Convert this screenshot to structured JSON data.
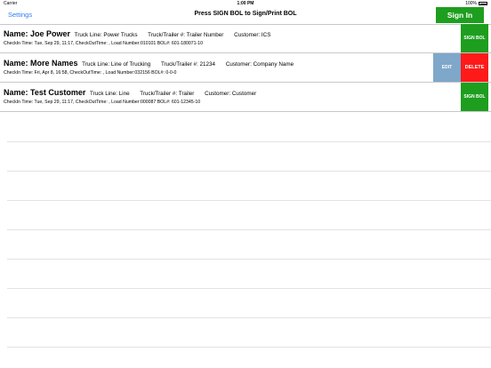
{
  "status_bar": {
    "carrier": "Carrier",
    "time": "1:00 PM",
    "battery": "100%"
  },
  "navbar": {
    "settings": "Settings",
    "title": "Press SIGN BOL to Sign/Print BOL",
    "sign_in": "Sign In"
  },
  "rows": [
    {
      "name": "Name: Joe Power",
      "truck_line": "Truck Line: Power Trucks",
      "trailer": "Truck/Trailer #: Trailer Number",
      "customer": "Customer: ICS",
      "details": "CheckIn Time: Tue, Sep 29, 11:17, CheckOutTime: , Load Number:010101 BOL#: 601-180071-10",
      "action": "SIGN BOL"
    },
    {
      "name": "Name: More Names",
      "truck_line": "Truck Line: Line of Trucking",
      "trailer": "Truck/Trailer #: 21234",
      "customer": "Customer: Company Name",
      "details": "CheckIn Time: Fri, Apr 8, 16:58, CheckOutTime: , Load Number:032156 BOL#: 0-0-0",
      "edit": "EDIT",
      "delete": "DELETE"
    },
    {
      "name": "Name: Test Customer",
      "truck_line": "Truck Line: Line",
      "trailer": "Truck/Trailer #: Trailer",
      "customer": "Customer: Customer",
      "details": "CheckIn Time: Tue, Sep 29, 11:17, CheckOutTime: , Load Number:000087 BOL#: 601-12345-10",
      "action": "SIGN BOL"
    }
  ]
}
